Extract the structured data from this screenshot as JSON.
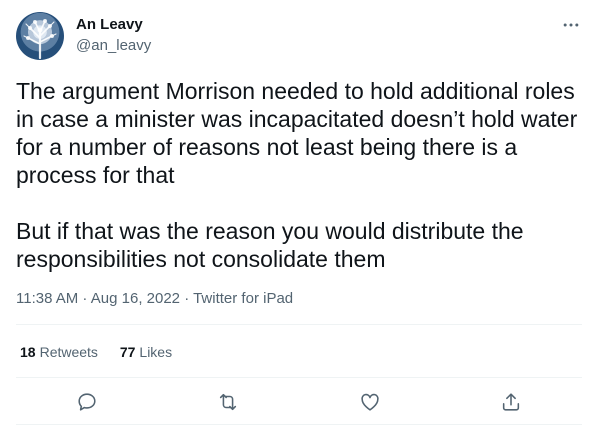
{
  "author": {
    "name": "An Leavy",
    "handle": "@an_leavy"
  },
  "tweet": {
    "text": "The argument Morrison needed to hold additional roles in case a minister was incapacitated doesn’t hold water for a number of reasons not least being there is a process for that\n\nBut if that was the reason you would distribute the responsibilities not consolidate them"
  },
  "meta": {
    "time": "11:38 AM",
    "date": "Aug 16, 2022",
    "source": "Twitter for iPad",
    "separator": " · "
  },
  "stats": {
    "retweets_count": "18",
    "retweets_label": "Retweets",
    "likes_count": "77",
    "likes_label": "Likes"
  },
  "icons": {
    "more": "more-icon",
    "reply": "reply-icon",
    "retweet": "retweet-icon",
    "like": "like-icon",
    "share": "share-icon"
  },
  "colors": {
    "text": "#0f1419",
    "secondary": "#536471",
    "divider": "#eff3f4"
  }
}
